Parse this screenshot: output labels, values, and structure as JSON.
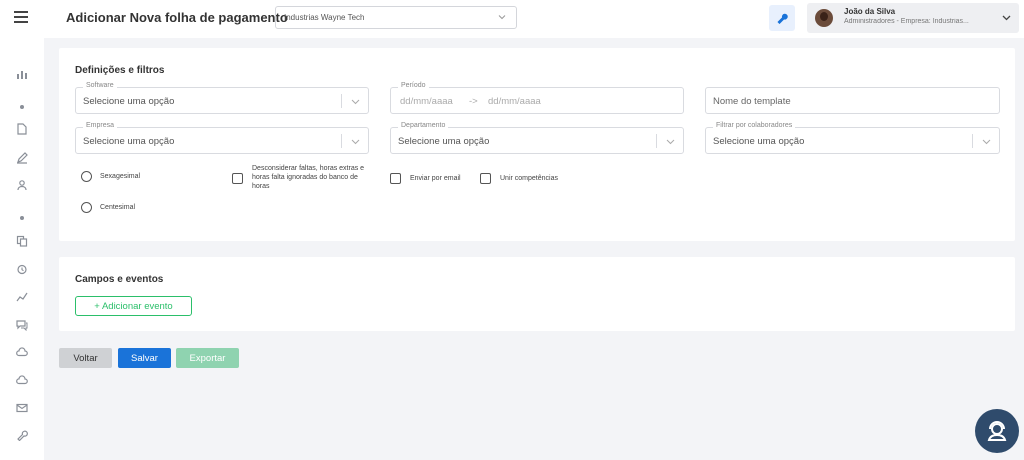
{
  "header": {
    "title": "Adicionar Nova folha de pagamento",
    "company_select": "Industrias Wayne Tech",
    "user_name": "João da Silva",
    "user_role": "Administradores - Empresa: Industrias..."
  },
  "settings": {
    "title": "Definições e filtros",
    "software": {
      "label": "Software",
      "value": "Selecione uma opção"
    },
    "periodo": {
      "label": "Período",
      "from": "dd/mm/aaaa",
      "arrow": "->",
      "to": "dd/mm/aaaa"
    },
    "template_name": {
      "placeholder": "Nome do template"
    },
    "empresa": {
      "label": "Empresa",
      "value": "Selecione uma opção"
    },
    "departamento": {
      "label": "Departamento",
      "value": "Selecione uma opção"
    },
    "colaboradores": {
      "label": "Filtrar por colaboradores",
      "value": "Selecione uma opção"
    },
    "radio_sexagesimal": "Sexagesimal",
    "radio_centesimal": "Centesimal",
    "check_desconsiderar": "Desconsiderar faltas, horas extras e horas falta ignoradas do banco de horas",
    "check_email": "Enviar por email",
    "check_unir": "Unir competências"
  },
  "events": {
    "title": "Campos e eventos",
    "add_button": "+ Adicionar evento"
  },
  "actions": {
    "back": "Voltar",
    "save": "Salvar",
    "export": "Exportar"
  },
  "colors": {
    "primary": "#1a73d9",
    "success": "#2bbf6a",
    "export_disabled": "#8fd3b0",
    "help_bg": "#2f4b6c"
  }
}
